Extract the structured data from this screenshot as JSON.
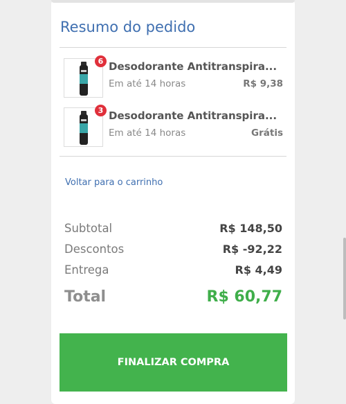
{
  "summary": {
    "title": "Resumo do pedido",
    "items": [
      {
        "quantity": "6",
        "name": "Desodorante Antitranspira...",
        "delivery": "Em até 14 horas",
        "price": "R$ 9,38",
        "icon": "deodorant-can-image"
      },
      {
        "quantity": "3",
        "name": "Desodorante Antitranspira...",
        "delivery": "Em até 14 horas",
        "price": "Grátis",
        "icon": "deodorant-can-image"
      }
    ],
    "back_link": "Voltar para o carrinho"
  },
  "totals": {
    "subtotal_label": "Subtotal",
    "subtotal_value": "R$ 148,50",
    "discounts_label": "Descontos",
    "discounts_value": "R$ -92,22",
    "delivery_label": "Entrega",
    "delivery_value": "R$ 4,49",
    "total_label": "Total",
    "total_value": "R$ 60,77"
  },
  "checkout": {
    "button_label": "FINALIZAR COMPRA"
  },
  "colors": {
    "accent_blue": "#3f6fb0",
    "badge_red": "#e0303b",
    "total_green": "#3fae4a",
    "button_green": "#43b34d"
  }
}
